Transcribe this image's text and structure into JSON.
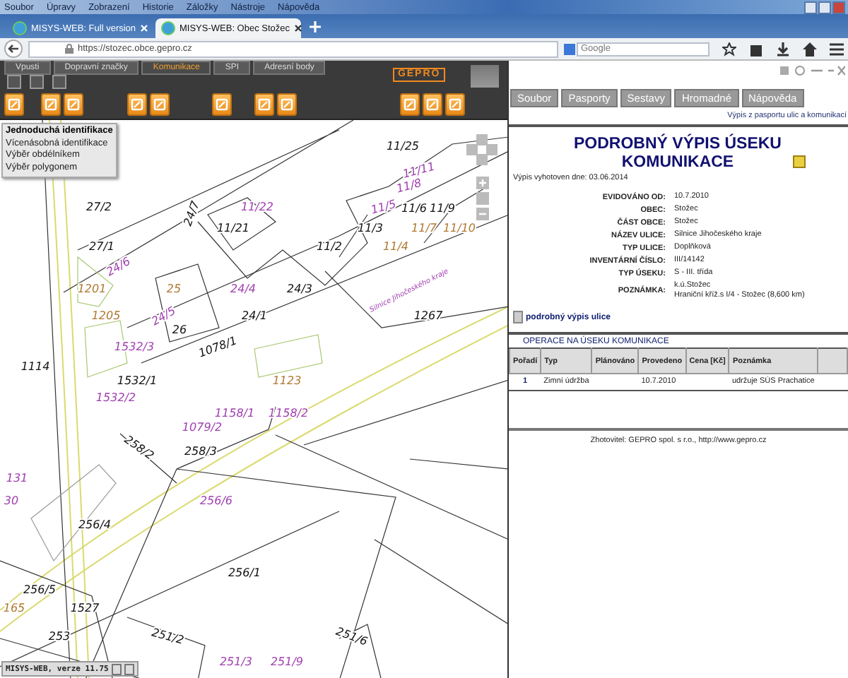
{
  "browser": {
    "menu": [
      "Soubor",
      "Úpravy",
      "Zobrazení",
      "Historie",
      "Záložky",
      "Nástroje",
      "Nápověda"
    ],
    "tabs": [
      {
        "title": "MISYS-WEB: Full version",
        "selected": false
      },
      {
        "title": "MISYS-WEB: Obec Stožec",
        "selected": true
      }
    ],
    "address": "https://stozec.obce.gepro.cz",
    "search": {
      "placeholder": "Google"
    }
  },
  "map_app": {
    "tabs": [
      {
        "label": "Vpusti",
        "selected": false
      },
      {
        "label": "Dopravní značky",
        "selected": false
      },
      {
        "label": "Komunikace",
        "selected": true
      },
      {
        "label": "SPI",
        "selected": false
      },
      {
        "label": "Adresní body",
        "selected": false
      }
    ],
    "logo": "GEPRO",
    "identify_menu": [
      {
        "label": "Jednoduchá identifikace",
        "selected": true
      },
      {
        "label": "Vícenásobná identifikace",
        "selected": false
      },
      {
        "label": "Výběr obdélníkem",
        "selected": false
      },
      {
        "label": "Výběr polygonem",
        "selected": false
      }
    ],
    "labels": [
      {
        "text": "11/25",
        "kind": "parcel"
      },
      {
        "text": "11/11",
        "kind": "reference"
      },
      {
        "text": "11/8",
        "kind": "reference"
      },
      {
        "text": "27/2",
        "kind": "parcel"
      },
      {
        "text": "24/7",
        "kind": "parcel"
      },
      {
        "text": "11/22",
        "kind": "reference"
      },
      {
        "text": "11/5",
        "kind": "reference"
      },
      {
        "text": "11/6",
        "kind": "parcel"
      },
      {
        "text": "11/9",
        "kind": "parcel"
      },
      {
        "text": "11/21",
        "kind": "parcel"
      },
      {
        "text": "11/3",
        "kind": "parcel"
      },
      {
        "text": "11/7",
        "kind": "building"
      },
      {
        "text": "11/10",
        "kind": "building"
      },
      {
        "text": "27/1",
        "kind": "parcel"
      },
      {
        "text": "11/2",
        "kind": "parcel"
      },
      {
        "text": "11/4",
        "kind": "building"
      },
      {
        "text": "24/6",
        "kind": "reference"
      },
      {
        "text": "1201",
        "kind": "building"
      },
      {
        "text": "25",
        "kind": "building"
      },
      {
        "text": "24/4",
        "kind": "reference"
      },
      {
        "text": "24/3",
        "kind": "parcel"
      },
      {
        "text": "Silnice Jihočeského kraje",
        "kind": "street"
      },
      {
        "text": "1205",
        "kind": "building"
      },
      {
        "text": "24/5",
        "kind": "reference"
      },
      {
        "text": "24/1",
        "kind": "parcel"
      },
      {
        "text": "1267",
        "kind": "parcel"
      },
      {
        "text": "26",
        "kind": "parcel"
      },
      {
        "text": "1532/3",
        "kind": "reference"
      },
      {
        "text": "1078/1",
        "kind": "parcel"
      },
      {
        "text": "1114",
        "kind": "parcel"
      },
      {
        "text": "1532/1",
        "kind": "parcel"
      },
      {
        "text": "1123",
        "kind": "building"
      },
      {
        "text": "1532/2",
        "kind": "reference"
      },
      {
        "text": "1158/1",
        "kind": "reference"
      },
      {
        "text": "1158/2",
        "kind": "reference"
      },
      {
        "text": "1079/2",
        "kind": "reference"
      },
      {
        "text": "258/2",
        "kind": "parcel"
      },
      {
        "text": "258/3",
        "kind": "parcel"
      },
      {
        "text": "131",
        "kind": "reference"
      },
      {
        "text": "30",
        "kind": "reference"
      },
      {
        "text": "256/6",
        "kind": "reference"
      },
      {
        "text": "256/4",
        "kind": "parcel"
      },
      {
        "text": "256/1",
        "kind": "parcel"
      },
      {
        "text": "256/5",
        "kind": "parcel"
      },
      {
        "text": "165",
        "kind": "building"
      },
      {
        "text": "1527",
        "kind": "parcel"
      },
      {
        "text": "253",
        "kind": "parcel"
      },
      {
        "text": "251/2",
        "kind": "parcel"
      },
      {
        "text": "251/6",
        "kind": "parcel"
      },
      {
        "text": "251/3",
        "kind": "reference"
      },
      {
        "text": "251/9",
        "kind": "reference"
      }
    ],
    "status": "MISYS-WEB, verze 11.75"
  },
  "report": {
    "menu": [
      "Soubor",
      "Pasporty",
      "Sestavy",
      "Hromadné",
      "Nápověda"
    ],
    "subtitle": "Výpis z pasportu ulic a komunikací",
    "title": "PODROBNÝ VÝPIS ÚSEKU KOMUNIKACE",
    "date": "Výpis vyhotoven dne: 03.06.2014",
    "fields": [
      {
        "label": "EVIDOVÁNO OD:",
        "value": "10.7.2010"
      },
      {
        "label": "OBEC:",
        "value": "Stožec"
      },
      {
        "label": "ČÁST OBCE:",
        "value": "Stožec"
      },
      {
        "label": "NÁZEV ULICE:",
        "value": "Silnice Jihočeského kraje"
      },
      {
        "label": "TYP ULICE:",
        "value": "Doplňková"
      },
      {
        "label": "INVENTÁRNÍ ČÍSLO:",
        "value": "III/14142"
      },
      {
        "label": "TYP ÚSEKU:",
        "value": "S - III. třída"
      },
      {
        "label": "POZNÁMKA:",
        "value": "k.ú.Stožec\nHraniční kříž.s I/4 - Stožec (8,600 km)"
      }
    ],
    "link": "podrobný výpis ulice",
    "operations": {
      "title": "OPERACE NA ÚSEKU KOMUNIKACE",
      "columns": [
        "Pořadí",
        "Typ",
        "Plánováno",
        "Provedeno",
        "Cena [Kč]",
        "Poznámka"
      ],
      "rows": [
        {
          "order": "1",
          "type": "Zimní údržba",
          "done": "10.7.2010",
          "note": "udržuje SÚS Prachatice"
        }
      ]
    },
    "footer": "Zhotovitel: GEPRO spol. s r.o., http://www.gepro.cz"
  }
}
